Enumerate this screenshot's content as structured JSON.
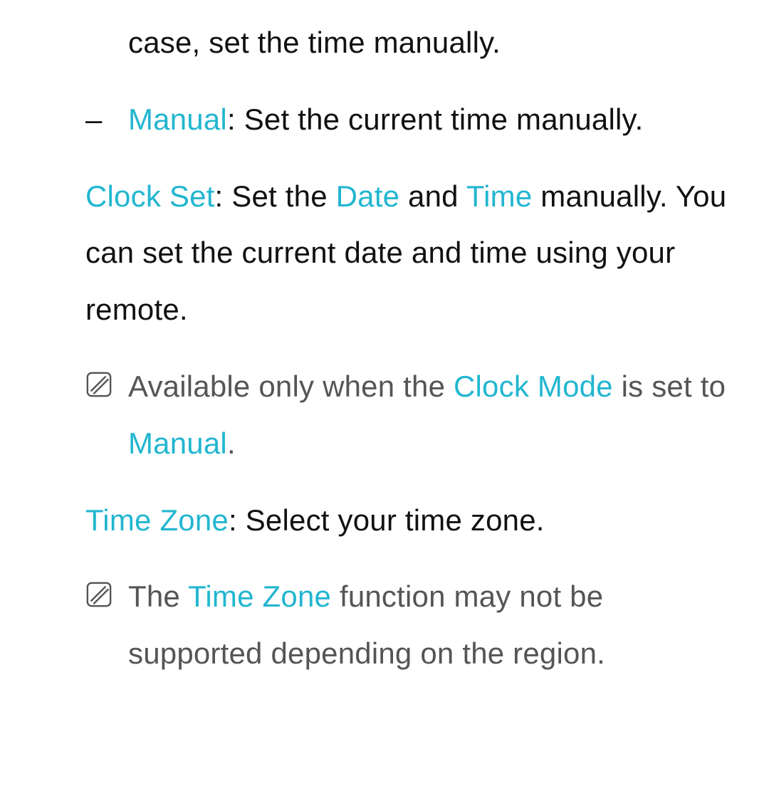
{
  "colors": {
    "highlight": "#22b6d0",
    "text": "#111111",
    "muted": "#555555"
  },
  "icons": {
    "note": "note-icon"
  },
  "top_fragment": "case, set the time manually.",
  "manual_item": {
    "dash": "–",
    "label": "Manual",
    "desc": ": Set the current time manually."
  },
  "clock_set": {
    "label": "Clock Set",
    "before_date": ": Set the ",
    "date": "Date",
    "between": " and ",
    "time": "Time",
    "after": " manually. You can set the current date and time using your remote."
  },
  "note1": {
    "before": "Available only when the ",
    "clock_mode": "Clock Mode",
    "mid": " is set to ",
    "manual": "Manual",
    "after": "."
  },
  "time_zone": {
    "label": "Time Zone",
    "desc": ": Select your time zone."
  },
  "note2": {
    "before": "The ",
    "tz": "Time Zone",
    "after": " function may not be supported depending on the region."
  }
}
